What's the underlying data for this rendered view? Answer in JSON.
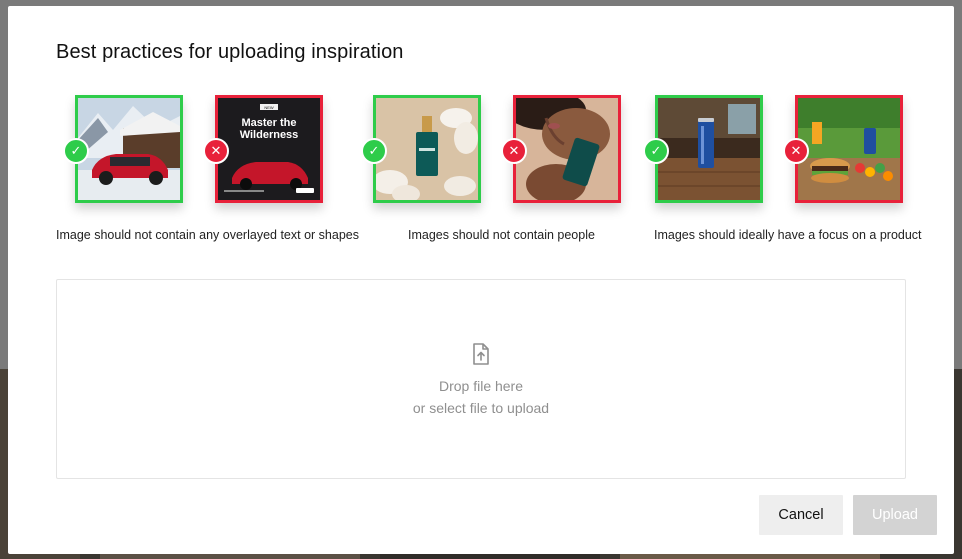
{
  "modal": {
    "title": "Best practices for uploading inspiration"
  },
  "examples": [
    {
      "caption": "Image should not contain any overlayed text or shapes",
      "good": {
        "icon": "check-icon",
        "subject": "red SUV in snowy mountain village"
      },
      "bad": {
        "icon": "cross-icon",
        "subject": "red SUV ad with overlay text",
        "overlay": {
          "tag": "NEW",
          "heading_line1": "Master the",
          "heading_line2": "Wilderness"
        }
      }
    },
    {
      "caption": "Images should not contain people",
      "good": {
        "icon": "check-icon",
        "subject": "green serum bottle with white flowers"
      },
      "bad": {
        "icon": "cross-icon",
        "subject": "woman holding green bottle"
      }
    },
    {
      "caption": "Images should ideally have a focus on a product",
      "good": {
        "icon": "check-icon",
        "subject": "blue can on wooden table"
      },
      "bad": {
        "icon": "cross-icon",
        "subject": "picnic table with burger and food"
      }
    }
  ],
  "dropzone": {
    "line1": "Drop file here",
    "line2": "or select file to upload"
  },
  "actions": {
    "cancel_label": "Cancel",
    "upload_label": "Upload"
  },
  "colors": {
    "good": "#2ecc4a",
    "bad": "#e8213a",
    "upload_disabled": "#d3d3d3",
    "cancel_bg": "#eeeeee"
  }
}
